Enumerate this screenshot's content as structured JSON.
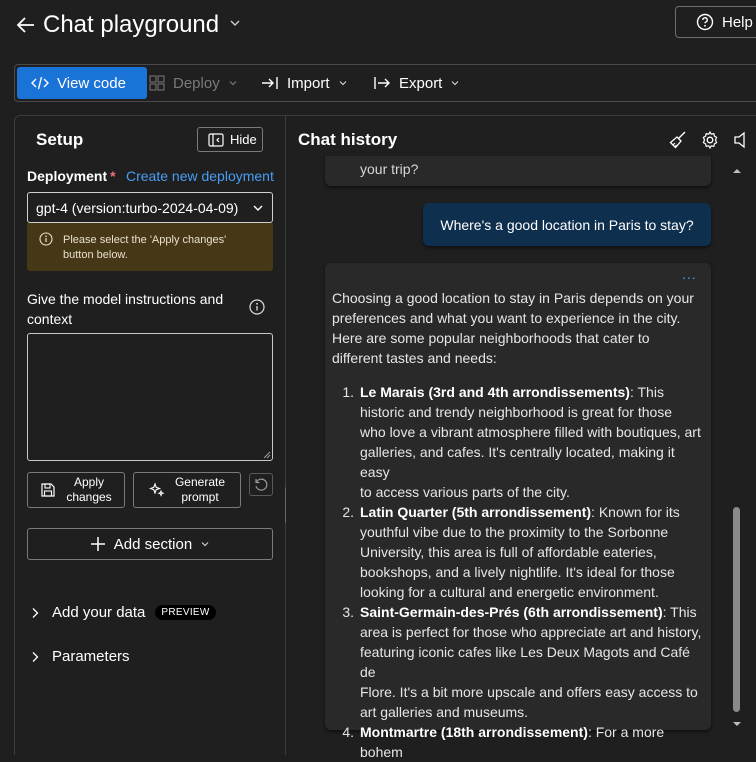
{
  "header": {
    "title": "Chat playground",
    "help_label": "Help"
  },
  "toolbar": {
    "view_code": "View code",
    "deploy": "Deploy",
    "import": "Import",
    "export": "Export"
  },
  "setup": {
    "title": "Setup",
    "hide_label": "Hide",
    "deployment_label": "Deployment",
    "required_mark": "*",
    "create_link": "Create new deployment",
    "deployment_value": "gpt-4 (version:turbo-2024-04-09)",
    "warning_line1": "Please select the 'Apply changes'",
    "warning_line2": "button below.",
    "instructions_label_line1": "Give the model instructions and",
    "instructions_label_line2": "context",
    "instructions_value": "",
    "apply_line1": "Apply",
    "apply_line2": "changes",
    "generate_line1": "Generate",
    "generate_line2": "prompt",
    "add_section": "Add section",
    "add_data": "Add your data",
    "preview_badge": "PREVIEW",
    "parameters": "Parameters"
  },
  "chat": {
    "title": "Chat history",
    "prev_tail": "your trip?",
    "user_message": "Where's a good location in Paris to stay?",
    "more": "...",
    "intro_lines": [
      "Choosing a good location to stay in Paris depends on your",
      "preferences and what you want to experience in the city.",
      "Here are some popular neighborhoods that cater to",
      "different tastes and needs:"
    ],
    "items": [
      {
        "num": "1.",
        "name": "Le Marais (3rd and 4th arrondissements)",
        "lines": [
          ": This",
          "historic and trendy neighborhood is great for those",
          "who love a vibrant atmosphere filled with boutiques, art",
          "galleries, and cafes. It's centrally located, making it easy",
          "to access various parts of the city."
        ]
      },
      {
        "num": "2.",
        "name": "Latin Quarter (5th arrondissement)",
        "lines": [
          ": Known for its",
          "youthful vibe due to the proximity to the Sorbonne",
          "University, this area is full of affordable eateries,",
          "bookshops, and a lively nightlife. It's ideal for those",
          "looking for a cultural and energetic environment."
        ]
      },
      {
        "num": "3.",
        "name": "Saint-Germain-des-Prés (6th arrondissement)",
        "lines": [
          ": This",
          "area is perfect for those who appreciate art and history,",
          "featuring iconic cafes like Les Deux Magots and Café de",
          "Flore. It's a bit more upscale and offers easy access to",
          "art galleries and museums."
        ]
      },
      {
        "num": "4.",
        "name": "Montmartre (18th arrondissement)",
        "lines": [
          ": For a more",
          "bohem"
        ]
      }
    ]
  },
  "colors": {
    "accent": "#1a73d6",
    "link": "#479ef5",
    "warning_bg": "#463816",
    "user_bubble": "#0f2f4e",
    "background": "#1f1f1f"
  },
  "icons": [
    "back-arrow-icon",
    "chevron-down-icon",
    "help-icon",
    "code-icon",
    "deploy-icon",
    "import-icon",
    "export-icon",
    "hide-panel-icon",
    "info-icon",
    "save-icon",
    "sparkle-icon",
    "reset-icon",
    "plus-icon",
    "chevron-right-icon",
    "broom-icon",
    "gear-icon",
    "speaker-icon"
  ]
}
